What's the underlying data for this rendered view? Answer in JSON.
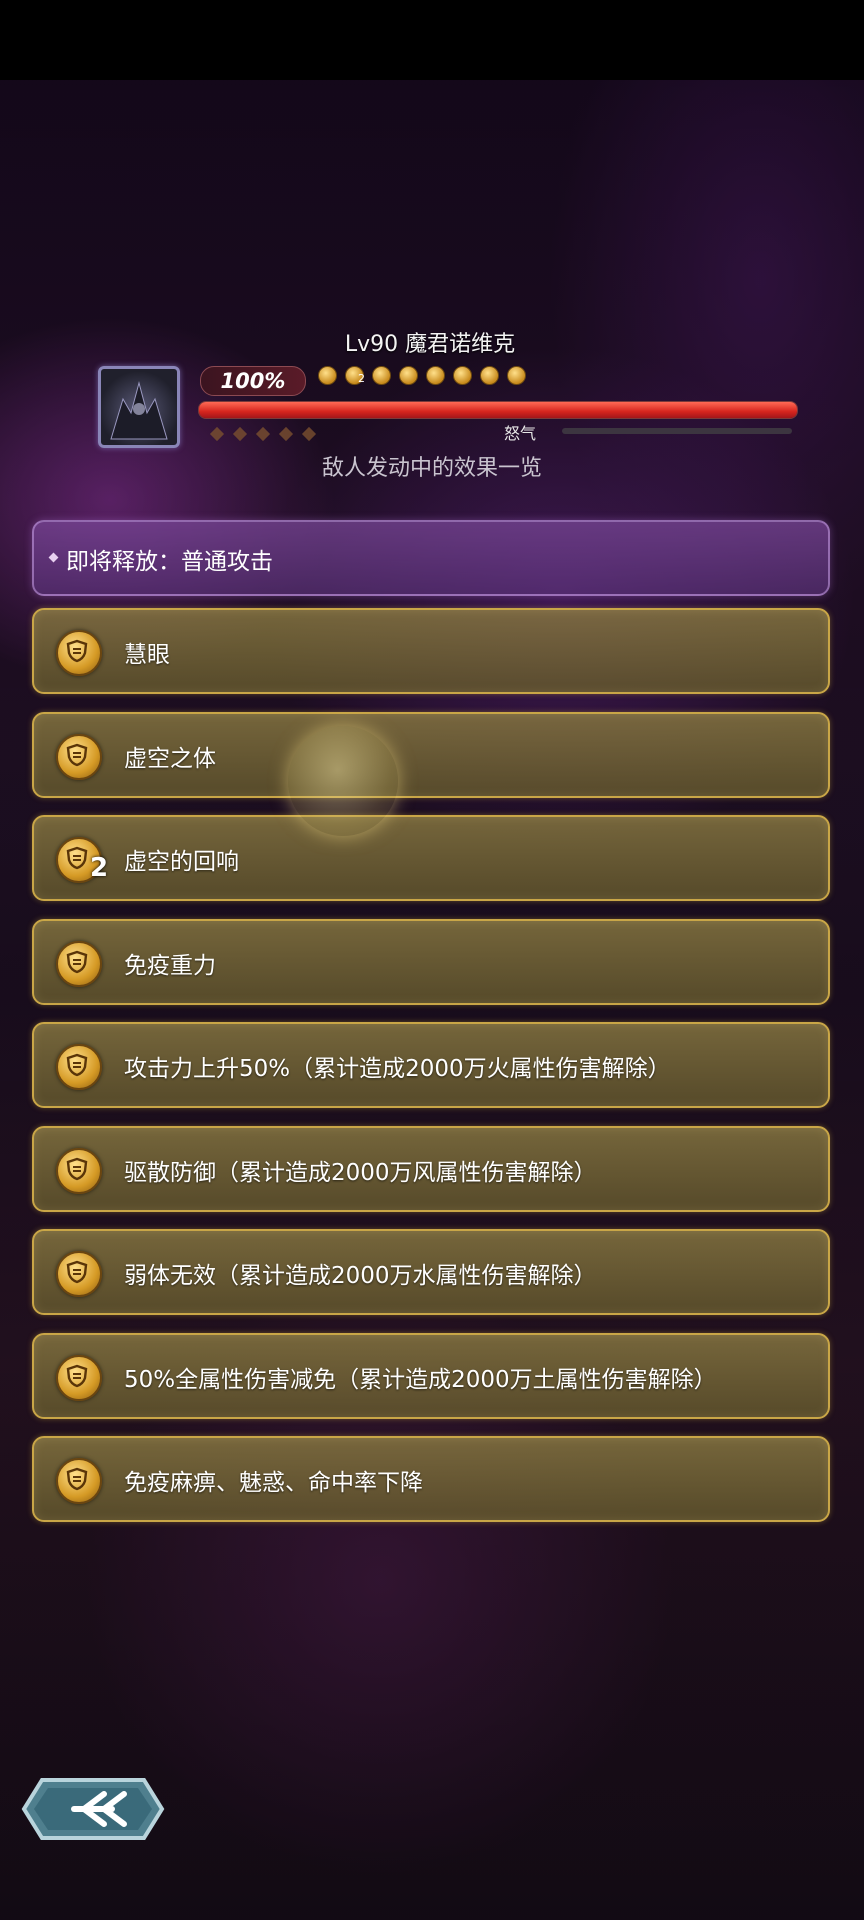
{
  "boss": {
    "name": "Lv90 魔君诺维克",
    "hp_percent_text": "100%",
    "hp_fill": 1.0,
    "token_count": 8,
    "token_number": "2",
    "rage_label": "怒气",
    "rage_fill": 0.0
  },
  "subtitle": "敌人发动中的效果一览",
  "next_action": "即将释放：普通攻击",
  "effects": [
    {
      "label": "慧眼"
    },
    {
      "label": "虚空之体"
    },
    {
      "label": "虚空的回响",
      "stack": "2"
    },
    {
      "label": "免疫重力"
    },
    {
      "label": "攻击力上升50%（累计造成2000万火属性伤害解除）"
    },
    {
      "label": "驱散防御（累计造成2000万风属性伤害解除）"
    },
    {
      "label": "弱体无效（累计造成2000万水属性伤害解除）"
    },
    {
      "label": "50%全属性伤害减免（累计造成2000万土属性伤害解除）"
    },
    {
      "label": "免疫麻痹、魅惑、命中率下降"
    }
  ],
  "icons": {
    "effect_badge": "shield-icon",
    "back": "back-arrow-icon",
    "portrait": "boss-portrait"
  },
  "colors": {
    "effect_border": "#c9a647",
    "hp_fill": "#d6251e",
    "next_panel": "#7a4a96"
  }
}
